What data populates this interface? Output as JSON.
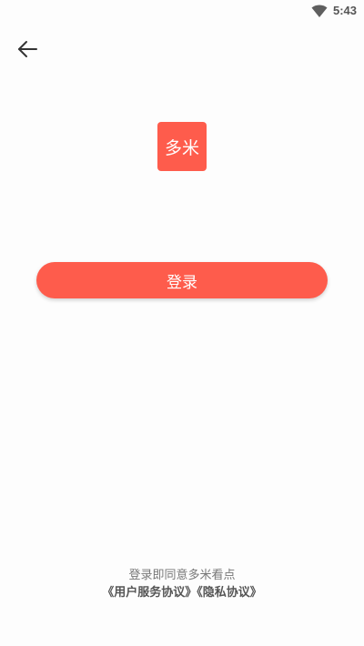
{
  "status_bar": {
    "time": "5:43",
    "wifi_icon": "wifi-icon"
  },
  "header": {
    "back_icon": "arrow-left-icon"
  },
  "logo": {
    "text": "多米"
  },
  "login": {
    "button_label": "登录"
  },
  "agreement": {
    "prefix": "登录即同意多米看点",
    "user_agreement": "《用户服务协议》",
    "privacy_policy": "《隐私协议》"
  },
  "colors": {
    "accent": "#fe5c4c",
    "text_muted": "#777777",
    "text_dark": "#555555"
  }
}
